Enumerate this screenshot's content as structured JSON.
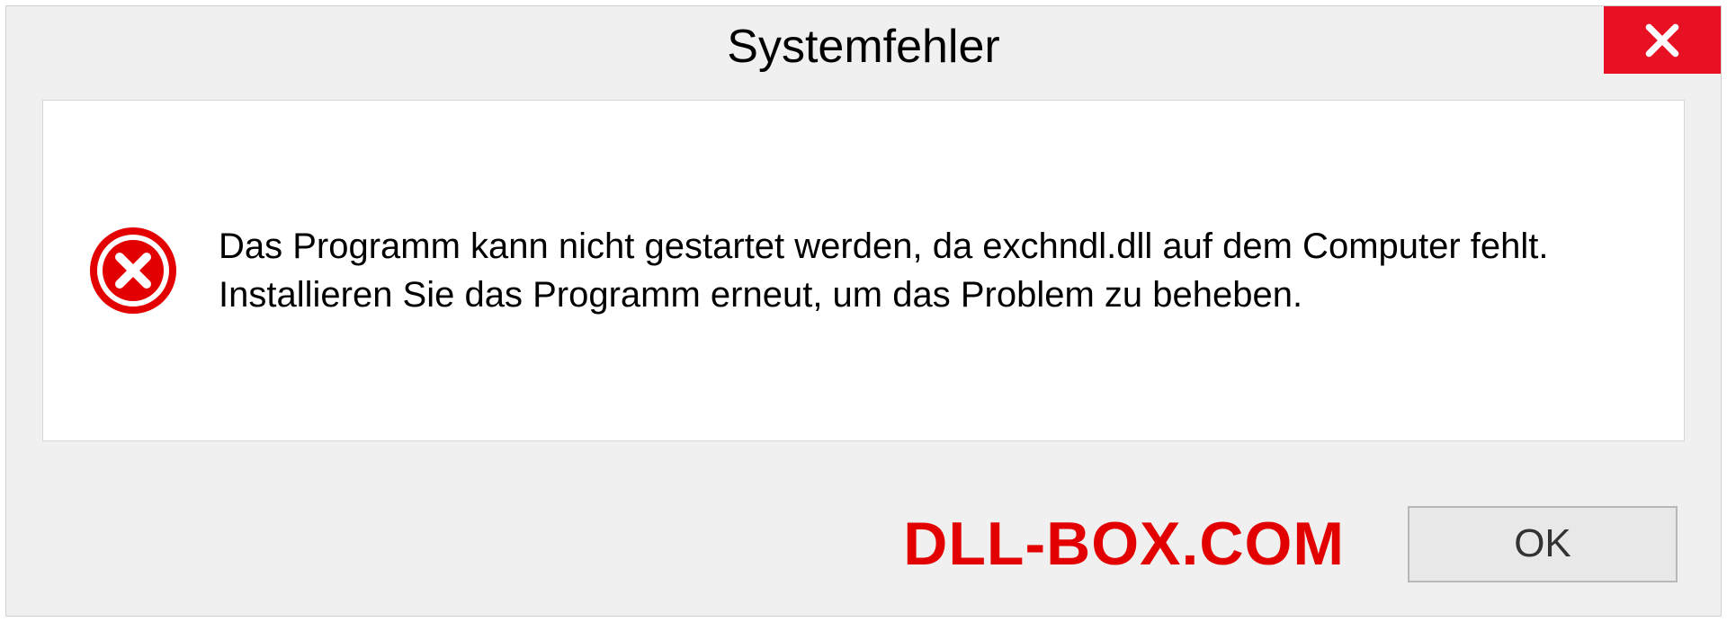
{
  "dialog": {
    "title": "Systemfehler",
    "message": "Das Programm kann nicht gestartet werden, da exchndl.dll auf dem Computer fehlt. Installieren Sie das Programm erneut, um das Problem zu beheben.",
    "ok_label": "OK"
  },
  "watermark": "DLL-BOX.COM"
}
